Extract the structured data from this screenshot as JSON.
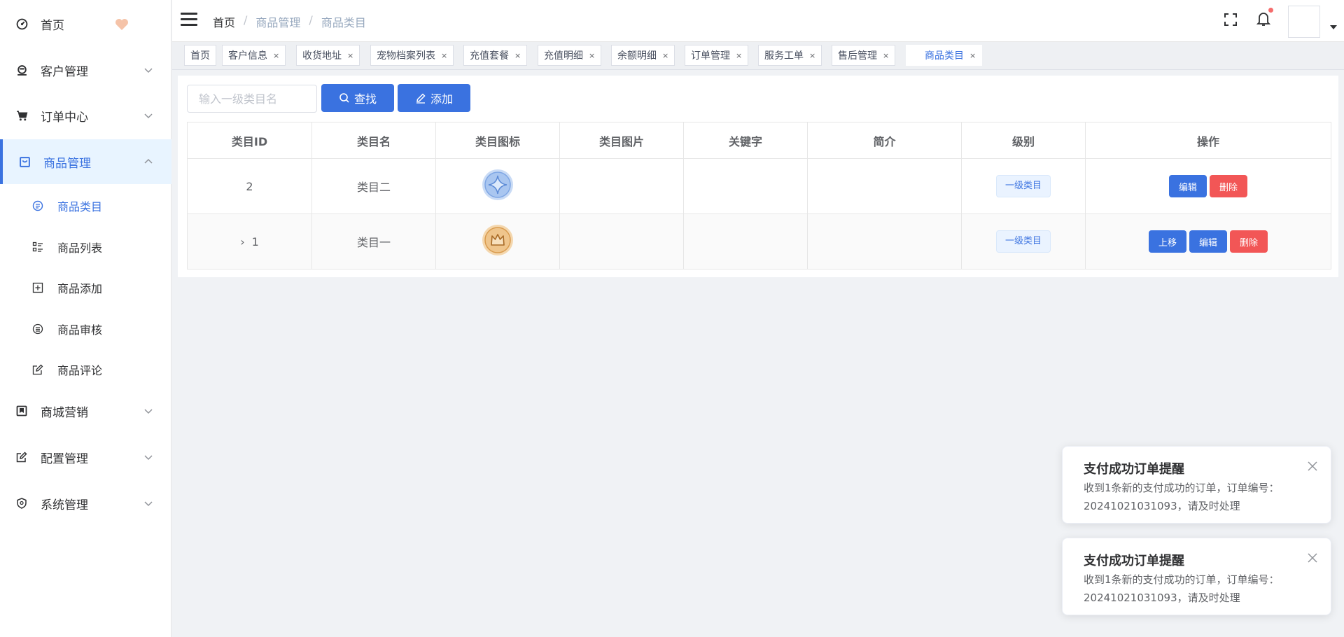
{
  "sidebar": {
    "items": [
      {
        "label": "首页",
        "icon": "dashboard-icon"
      },
      {
        "label": "客户管理",
        "icon": "customer-icon"
      },
      {
        "label": "订单中心",
        "icon": "cart-icon"
      },
      {
        "label": "商品管理",
        "icon": "shopping-bag-icon"
      },
      {
        "label": "商城营销",
        "icon": "marketing-icon"
      },
      {
        "label": "配置管理",
        "icon": "edit-icon"
      },
      {
        "label": "系统管理",
        "icon": "shield-icon"
      }
    ],
    "sub_items": [
      {
        "label": "商品类目",
        "icon": "list-circle-icon"
      },
      {
        "label": "商品列表",
        "icon": "list-icon"
      },
      {
        "label": "商品添加",
        "icon": "plus-square-icon"
      },
      {
        "label": "商品审核",
        "icon": "audit-icon"
      },
      {
        "label": "商品评论",
        "icon": "comment-edit-icon"
      }
    ],
    "heart_color": "#f5c3a8"
  },
  "header": {
    "breadcrumb": [
      "首页",
      "商品管理",
      "商品类目"
    ],
    "breadcrumb_separator": "/"
  },
  "tags": [
    {
      "label": "首页",
      "closable": false
    },
    {
      "label": "客户信息",
      "closable": true
    },
    {
      "label": "收货地址",
      "closable": true
    },
    {
      "label": "宠物档案列表",
      "closable": true
    },
    {
      "label": "充值套餐",
      "closable": true
    },
    {
      "label": "充值明细",
      "closable": true
    },
    {
      "label": "余额明细",
      "closable": true
    },
    {
      "label": "订单管理",
      "closable": true
    },
    {
      "label": "服务工单",
      "closable": true
    },
    {
      "label": "售后管理",
      "closable": true
    },
    {
      "label": "商品类目",
      "closable": true,
      "active": true
    }
  ],
  "tag_close_glyph": "×",
  "toolbar": {
    "search_placeholder": "输入一级类目名",
    "search_value": "",
    "search_label": "查找",
    "add_label": "添加"
  },
  "table": {
    "columns": [
      "类目ID",
      "类目名",
      "类目图标",
      "类目图片",
      "关键字",
      "简介",
      "级别",
      "操作"
    ],
    "rows": [
      {
        "id": "2",
        "name": "类目二",
        "icon": "star-badge-icon",
        "image": "",
        "keywords": "",
        "intro": "",
        "level": "一级类目",
        "ops": [
          "编辑",
          "删除"
        ],
        "expandable": false
      },
      {
        "id": "1",
        "name": "类目一",
        "icon": "crown-badge-icon",
        "image": "",
        "keywords": "",
        "intro": "",
        "level": "一级类目",
        "ops": [
          "上移",
          "编辑",
          "删除"
        ],
        "expandable": true
      }
    ]
  },
  "notifications": [
    {
      "title": "支付成功订单提醒",
      "message": "收到1条新的支付成功的订单，订单编号：20241021031093，请及时处理"
    },
    {
      "title": "支付成功订单提醒",
      "message": "收到1条新的支付成功的订单，订单编号：20241021031093，请及时处理"
    }
  ],
  "colors": {
    "primary": "#3a72e0",
    "danger": "#f25656",
    "notification_dot": "#f56c6c"
  }
}
